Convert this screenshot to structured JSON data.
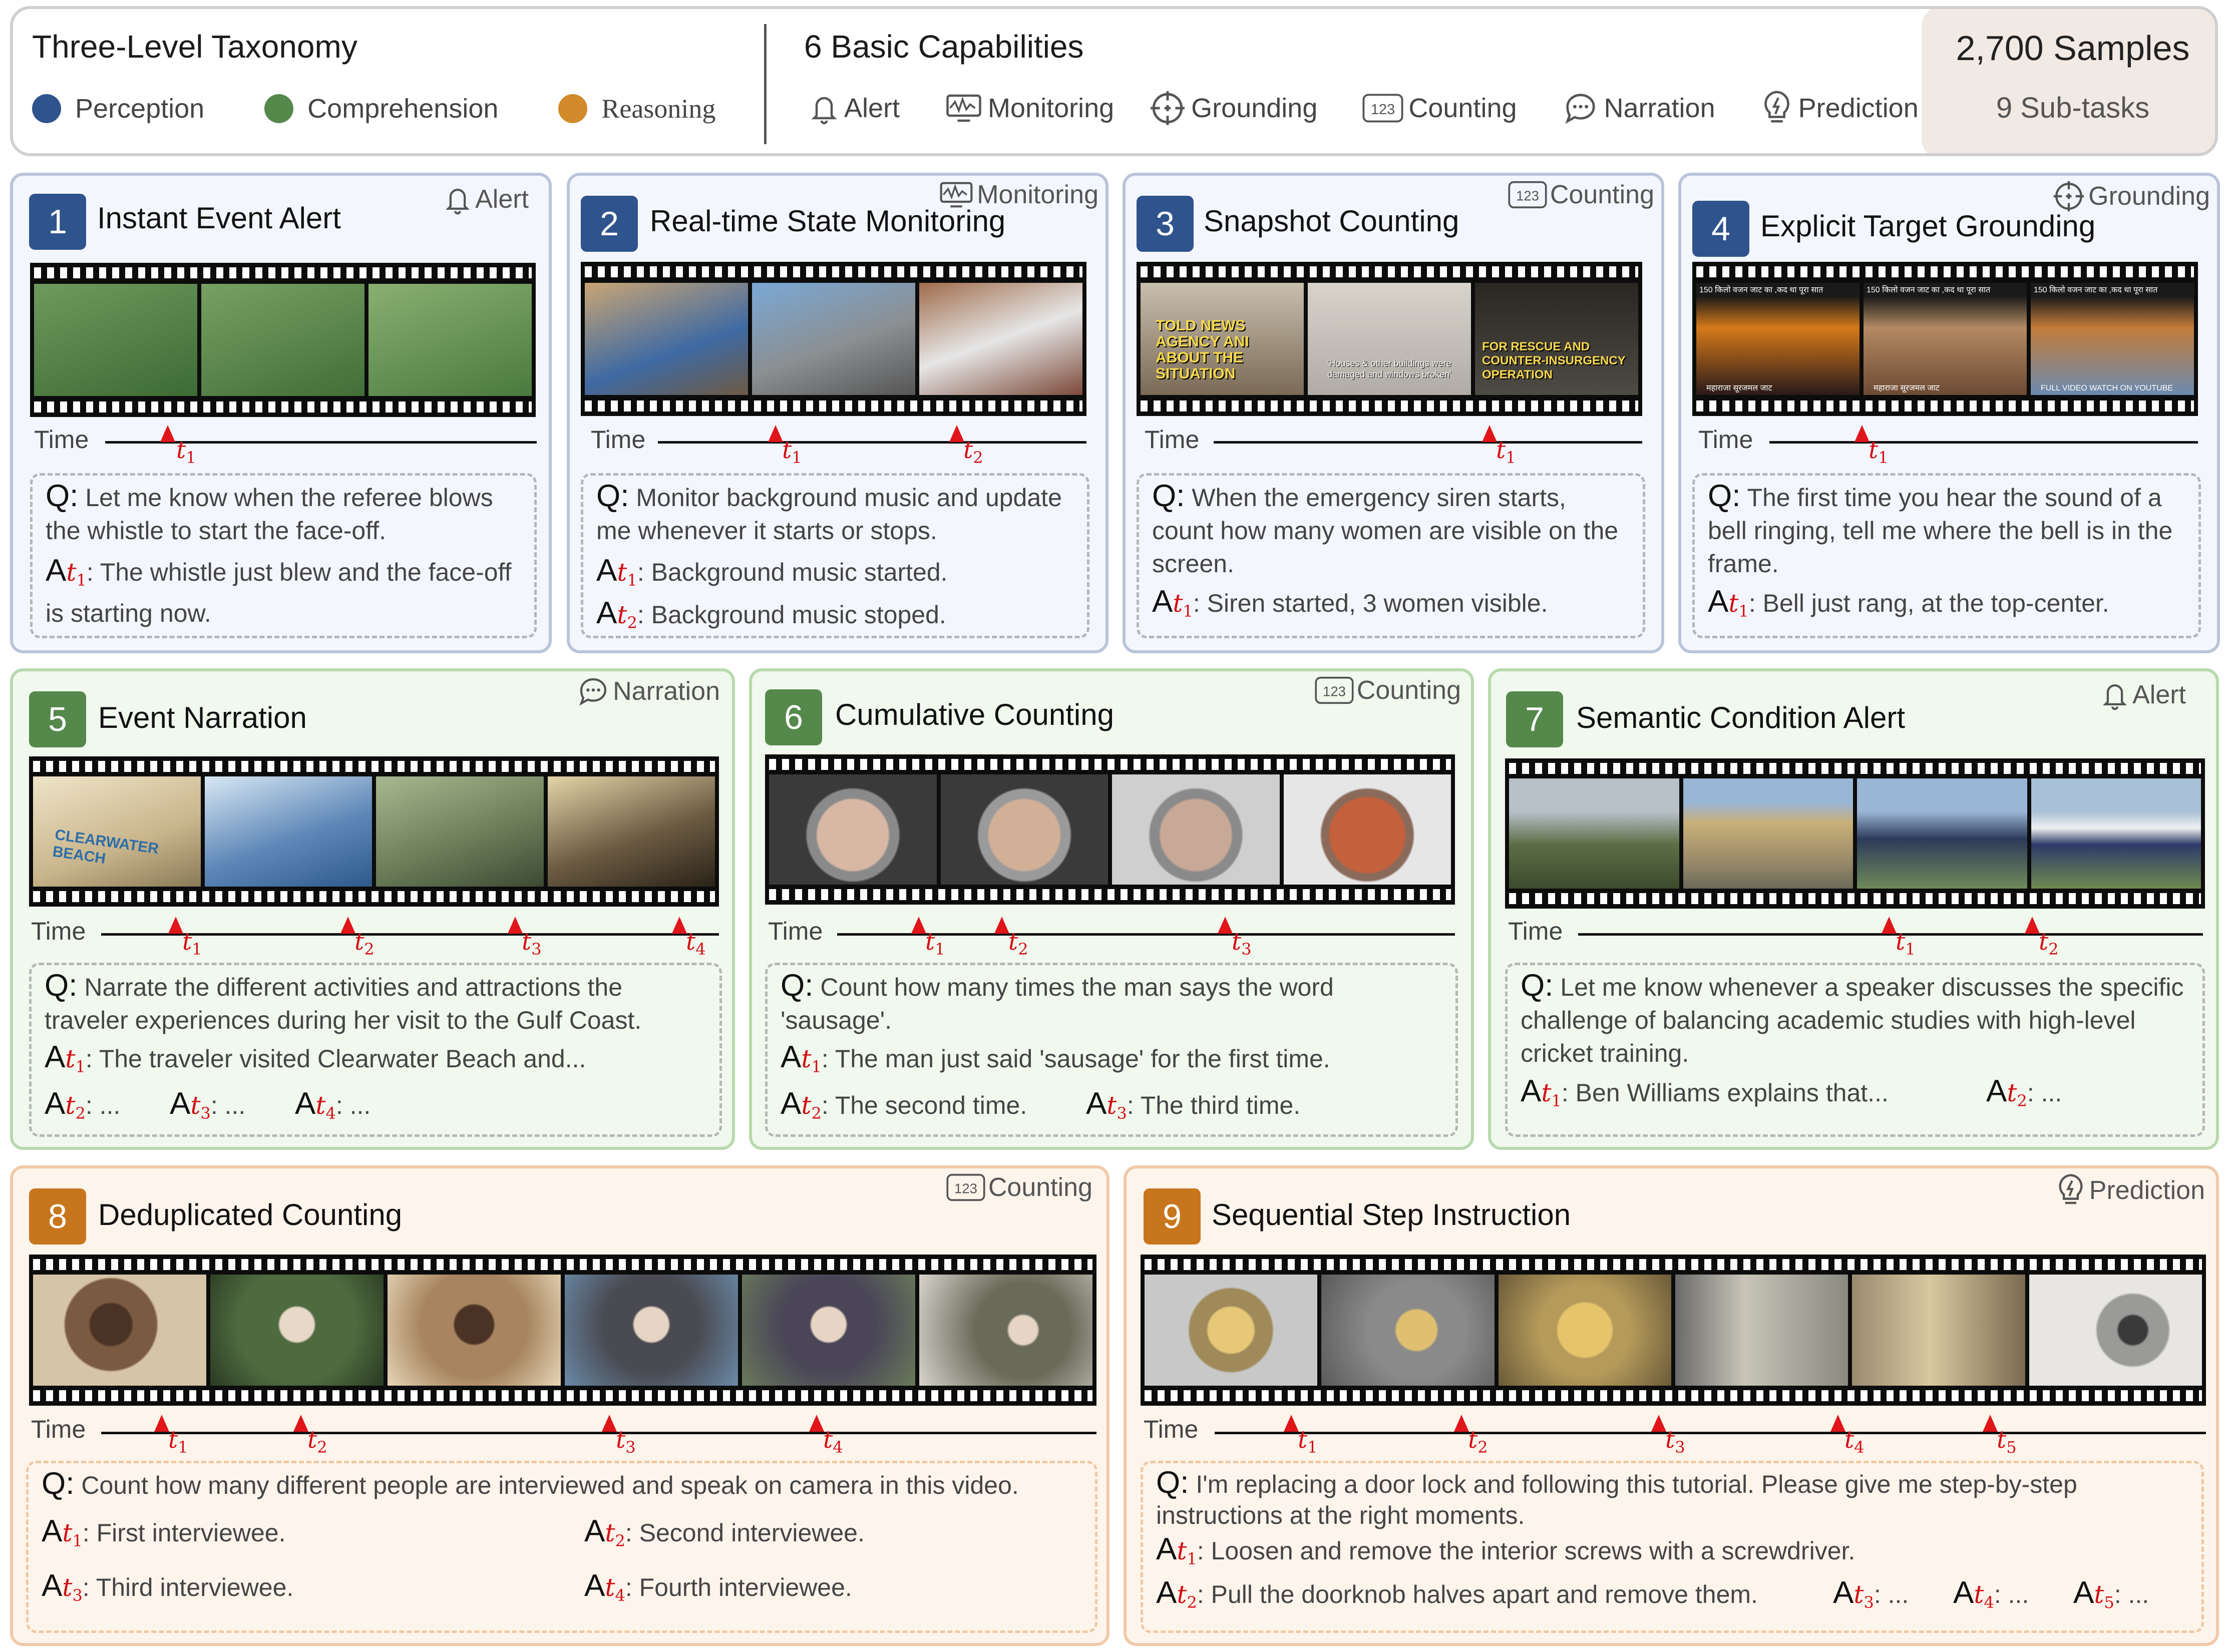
{
  "header": {
    "taxonomy_title": "Three-Level Taxonomy",
    "levels": [
      {
        "label": "Perception",
        "color": "#2f538c"
      },
      {
        "label": "Comprehension",
        "color": "#55884b"
      },
      {
        "label": "Reasoning",
        "color": "#d08a2a"
      }
    ],
    "capabilities_title": "6 Basic Capabilities",
    "capabilities": [
      "Alert",
      "Monitoring",
      "Grounding",
      "Counting",
      "Narration",
      "Prediction"
    ],
    "samples": "2,700 Samples",
    "subtasks": "9 Sub-tasks"
  },
  "common": {
    "time_label": "Time",
    "q_prefix": "Q:",
    "a_prefix": "A",
    "ellipsis": ": ...",
    "t": "t"
  },
  "tasks": [
    {
      "num": "1",
      "title": "Instant Event Alert",
      "capability": "Alert",
      "question": "Let me know when the referee blows the whistle to start the face-off.",
      "answers": [
        "The whistle just blew and the face-off is starting now."
      ],
      "frames": [
        "#3d6b35",
        "#426f38",
        "#4a7a3f"
      ]
    },
    {
      "num": "2",
      "title": "Real-time State Monitoring",
      "capability": "Monitoring",
      "question": "Monitor background music and update me whenever it starts or stops.",
      "answers": [
        "Background music started.",
        "Background music stoped."
      ],
      "frames": [
        "#6d5a44",
        "#8b8f92",
        "#7c4a3a"
      ]
    },
    {
      "num": "3",
      "title": "Snapshot Counting",
      "capability": "Counting",
      "question": "When the emergency siren starts, count how many women are visible on the screen.",
      "answers": [
        "Siren started, 3 women visible."
      ],
      "frames": [
        "#7a6a56",
        "#b0aba5",
        "#4e4a44"
      ],
      "captions": [
        "TOLD NEWS AGENCY ANI ABOUT THE SITUATION",
        "'Houses & other buildings were damaged and windows broken'",
        "FOR RESCUE AND COUNTER-INSURGENCY OPERATION"
      ]
    },
    {
      "num": "4",
      "title": "Explicit Target Grounding",
      "capability": "Grounding",
      "question": "The first time you hear the sound of a bell ringing, tell me where the bell is in the frame.",
      "answers": [
        "Bell just rang, at the top-center."
      ],
      "frames": [
        "#d67a1a",
        "#b38a62",
        "#c47c3a"
      ],
      "captions": [
        "150 किलो वजन जाट का ,कद था पूरा सात",
        "महाराजा सूरजमल जाट",
        "FULL VIDEO WATCH ON YOUTUBE"
      ]
    },
    {
      "num": "5",
      "title": "Event Narration",
      "capability": "Narration",
      "question": "Narrate the different activities and attractions the traveler experiences during her visit to the Gulf Coast.",
      "answers": [
        "The traveler visited Clearwater Beach and..."
      ],
      "frames": [
        "#c9b58c",
        "#5f88b8",
        "#6d7f5a",
        "#6d5c43"
      ],
      "captions": [
        "CLEARWATER BEACH"
      ]
    },
    {
      "num": "6",
      "title": "Cumulative Counting",
      "capability": "Counting",
      "question": "Count how many times the man says the word 'sausage'.",
      "answers": [
        "The man just said 'sausage' for the first time.",
        "The second time.",
        "The third time."
      ],
      "frames": [
        "#b29c90",
        "#b09a86",
        "#9a8c84",
        "#b35a3a"
      ]
    },
    {
      "num": "7",
      "title": "Semantic Condition Alert",
      "capability": "Alert",
      "question": "Let me know whenever a speaker discusses the specific challenge of balancing academic studies with high-level cricket training.",
      "answers": [
        "Ben Williams explains that..."
      ],
      "frames": [
        "#5c6e45",
        "#9a8a6a",
        "#6f8a5a",
        "#6f8a4f"
      ]
    },
    {
      "num": "8",
      "title": "Deduplicated Counting",
      "capability": "Counting",
      "question": "Count how many different people are interviewed and speak on camera in this video.",
      "answers": [
        "First interviewee.",
        "Second interviewee.",
        "Third interviewee.",
        "Fourth interviewee."
      ],
      "frames": [
        "#7b5a42",
        "#4e6a3f",
        "#a88560",
        "#4a4a52",
        "#4a4658",
        "#6a6a5a"
      ]
    },
    {
      "num": "9",
      "title": "Sequential Step Instruction",
      "capability": "Prediction",
      "question": "I'm replacing a door lock and following this tutorial. Please give me step-by-step instructions at the right moments.",
      "answers": [
        "Loosen and remove the interior screws with a screwdriver.",
        "Pull the doorknob halves apart and remove them."
      ],
      "frames": [
        "#a08a5a",
        "#8a8a8a",
        "#b59a5a",
        "#8a8a80",
        "#9a8a70",
        "#9a9a98"
      ]
    }
  ]
}
